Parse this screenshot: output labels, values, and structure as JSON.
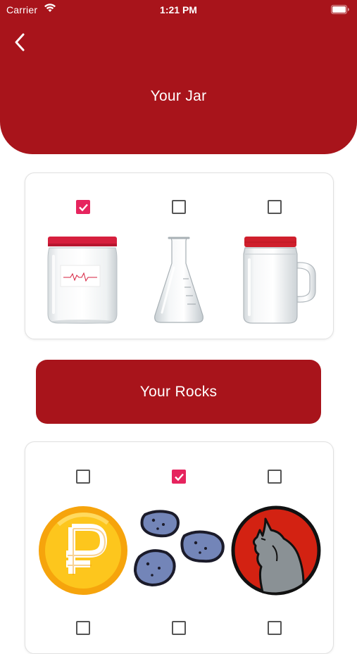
{
  "status_bar": {
    "carrier": "Carrier",
    "time": "1:21 PM"
  },
  "header": {
    "title": "Your Jar",
    "background_color": "#a8141b"
  },
  "jars": [
    {
      "icon": "labeled-jar-icon",
      "checked": true
    },
    {
      "icon": "erlenmeyer-flask-icon",
      "checked": false
    },
    {
      "icon": "mason-jar-mug-icon",
      "checked": false
    }
  ],
  "rocks_button": {
    "label": "Your Rocks"
  },
  "rocks": [
    {
      "icon": "ruble-coin-icon",
      "checked": false
    },
    {
      "icon": "blue-rocks-icon",
      "checked": true
    },
    {
      "icon": "howling-wolf-icon",
      "checked": false
    },
    {
      "icon": "",
      "checked": false
    },
    {
      "icon": "",
      "checked": false
    },
    {
      "icon": "",
      "checked": false
    }
  ],
  "colors": {
    "accent": "#a8141b",
    "checkbox_checked": "#e6245e"
  }
}
